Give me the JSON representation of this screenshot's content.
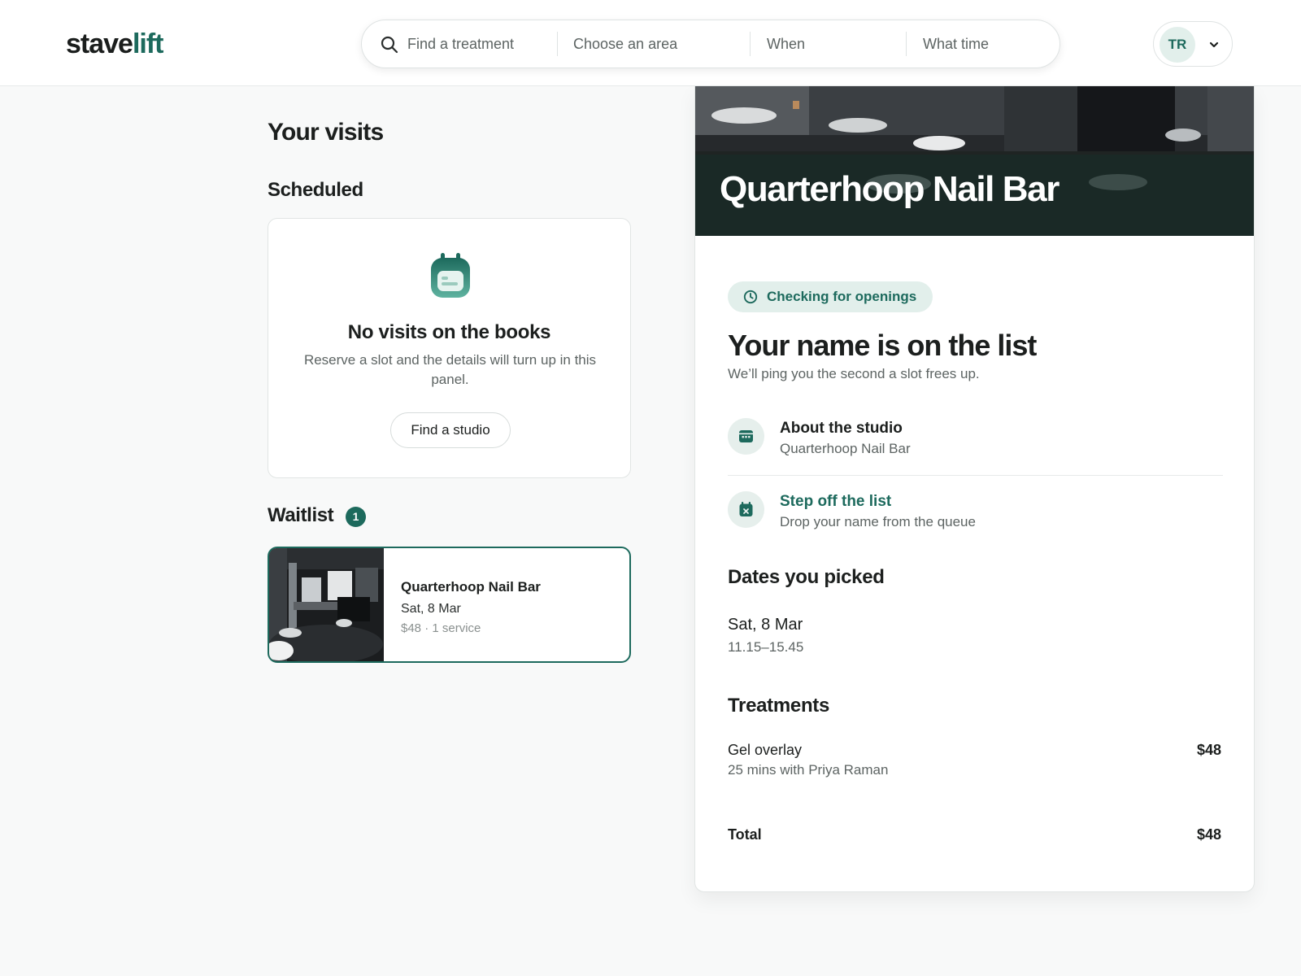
{
  "brand": {
    "logo_part1": "stave",
    "logo_part2": "lift",
    "accent_color": "#1d6a5d"
  },
  "search": {
    "icon": "search-icon",
    "treatment_placeholder": "Find a treatment",
    "area_placeholder": "Choose an area",
    "when_placeholder": "When",
    "time_placeholder": "What time"
  },
  "user": {
    "initials": "TR",
    "menu_icon": "chevron-down-icon"
  },
  "visits": {
    "page_title": "Your visits",
    "scheduled": {
      "title": "Scheduled",
      "empty_icon": "calendar-icon",
      "empty_title": "No visits on the books",
      "empty_desc": "Reserve a slot and the details will turn up in this panel.",
      "cta_label": "Find a studio"
    },
    "waitlist": {
      "title": "Waitlist",
      "count": "1",
      "items": [
        {
          "studio": "Quarterhoop Nail Bar",
          "date": "Sat, 8 Mar",
          "meta": "$48 · 1 service"
        }
      ]
    }
  },
  "detail": {
    "studio_name": "Quarterhoop Nail Bar",
    "status": {
      "icon": "clock-icon",
      "label": "Checking for openings"
    },
    "title": "Your name is on the list",
    "subtitle": "We’ll ping you the second a slot frees up.",
    "actions": [
      {
        "icon": "storefront-icon",
        "label": "About the studio",
        "desc": "Quarterhoop Nail Bar"
      },
      {
        "icon": "calendar-x-icon",
        "label": "Step off the list",
        "desc": "Drop your name from the queue"
      }
    ],
    "dates": {
      "title": "Dates you picked",
      "items": [
        {
          "date": "Sat, 8 Mar",
          "time": "11.15–15.45"
        }
      ]
    },
    "treatments": {
      "title": "Treatments",
      "items": [
        {
          "name": "Gel overlay",
          "detail": "25 mins with Priya Raman",
          "price": "$48"
        }
      ],
      "total_label": "Total",
      "total_price": "$48"
    }
  }
}
